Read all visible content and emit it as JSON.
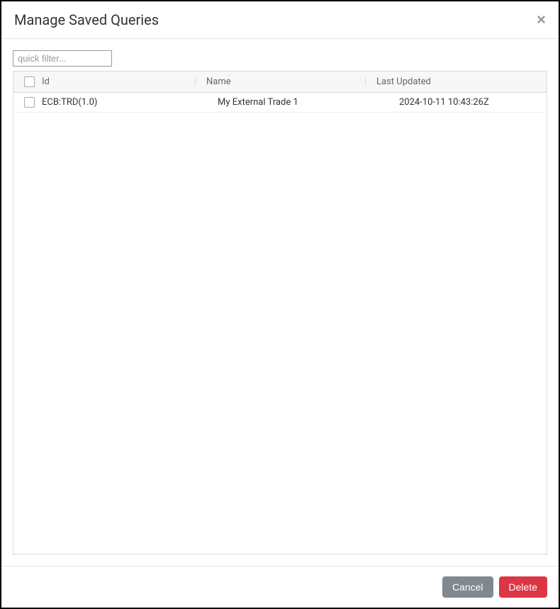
{
  "header": {
    "title": "Manage Saved Queries",
    "close_label": "×"
  },
  "filter": {
    "placeholder": "quick filter...",
    "value": ""
  },
  "table": {
    "columns": {
      "id": "Id",
      "name": "Name",
      "last_updated": "Last Updated"
    },
    "rows": [
      {
        "id": "ECB:TRD(1.0)",
        "name": "My External Trade 1",
        "last_updated": "2024-10-11 10:43:26Z",
        "checked": false
      }
    ]
  },
  "footer": {
    "cancel_label": "Cancel",
    "delete_label": "Delete"
  }
}
